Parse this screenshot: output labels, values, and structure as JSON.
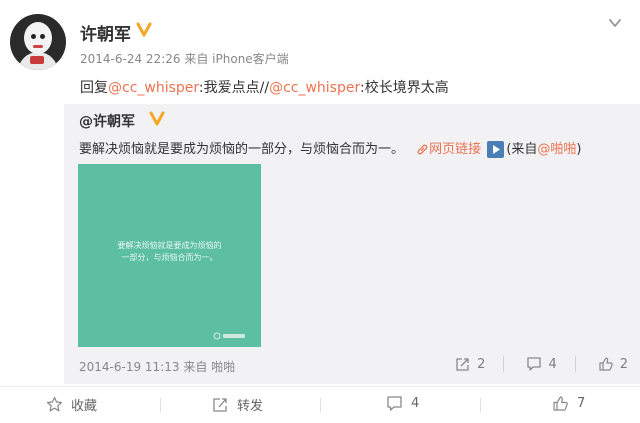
{
  "post": {
    "author": "许朝军",
    "timestamp": "2014-6-24 22:26",
    "source_prefix": "来自",
    "source": "iPhone客户端",
    "reply": {
      "prefix": "回复",
      "mention1": "@cc_whisper",
      "text1": ":我爱点点//",
      "mention2": "@cc_whisper",
      "text2": ":校长境界太高"
    }
  },
  "original": {
    "author": "@许朝军",
    "text": "要解决烦恼就是要成为烦恼的一部分，与烦恼合而为一。",
    "link_label": "网页链接",
    "source_open": "(来自",
    "source_app": "@啪啪",
    "source_close": ")",
    "image_line1": "要解决烦恼就是要成为烦恼的",
    "image_line2": "一部分，与烦恼合而为一。",
    "timestamp": "2014-6-19 11:13",
    "source_prefix": "来自",
    "source": "啪啪",
    "forward_count": "2",
    "comment_count": "4",
    "like_count": "2"
  },
  "actions": {
    "favorite": "收藏",
    "forward": "转发",
    "comment": "4",
    "like": "7"
  },
  "colors": {
    "accent": "#eb7350",
    "verified": "#f5a623",
    "image_bg": "#5cbfa2"
  }
}
